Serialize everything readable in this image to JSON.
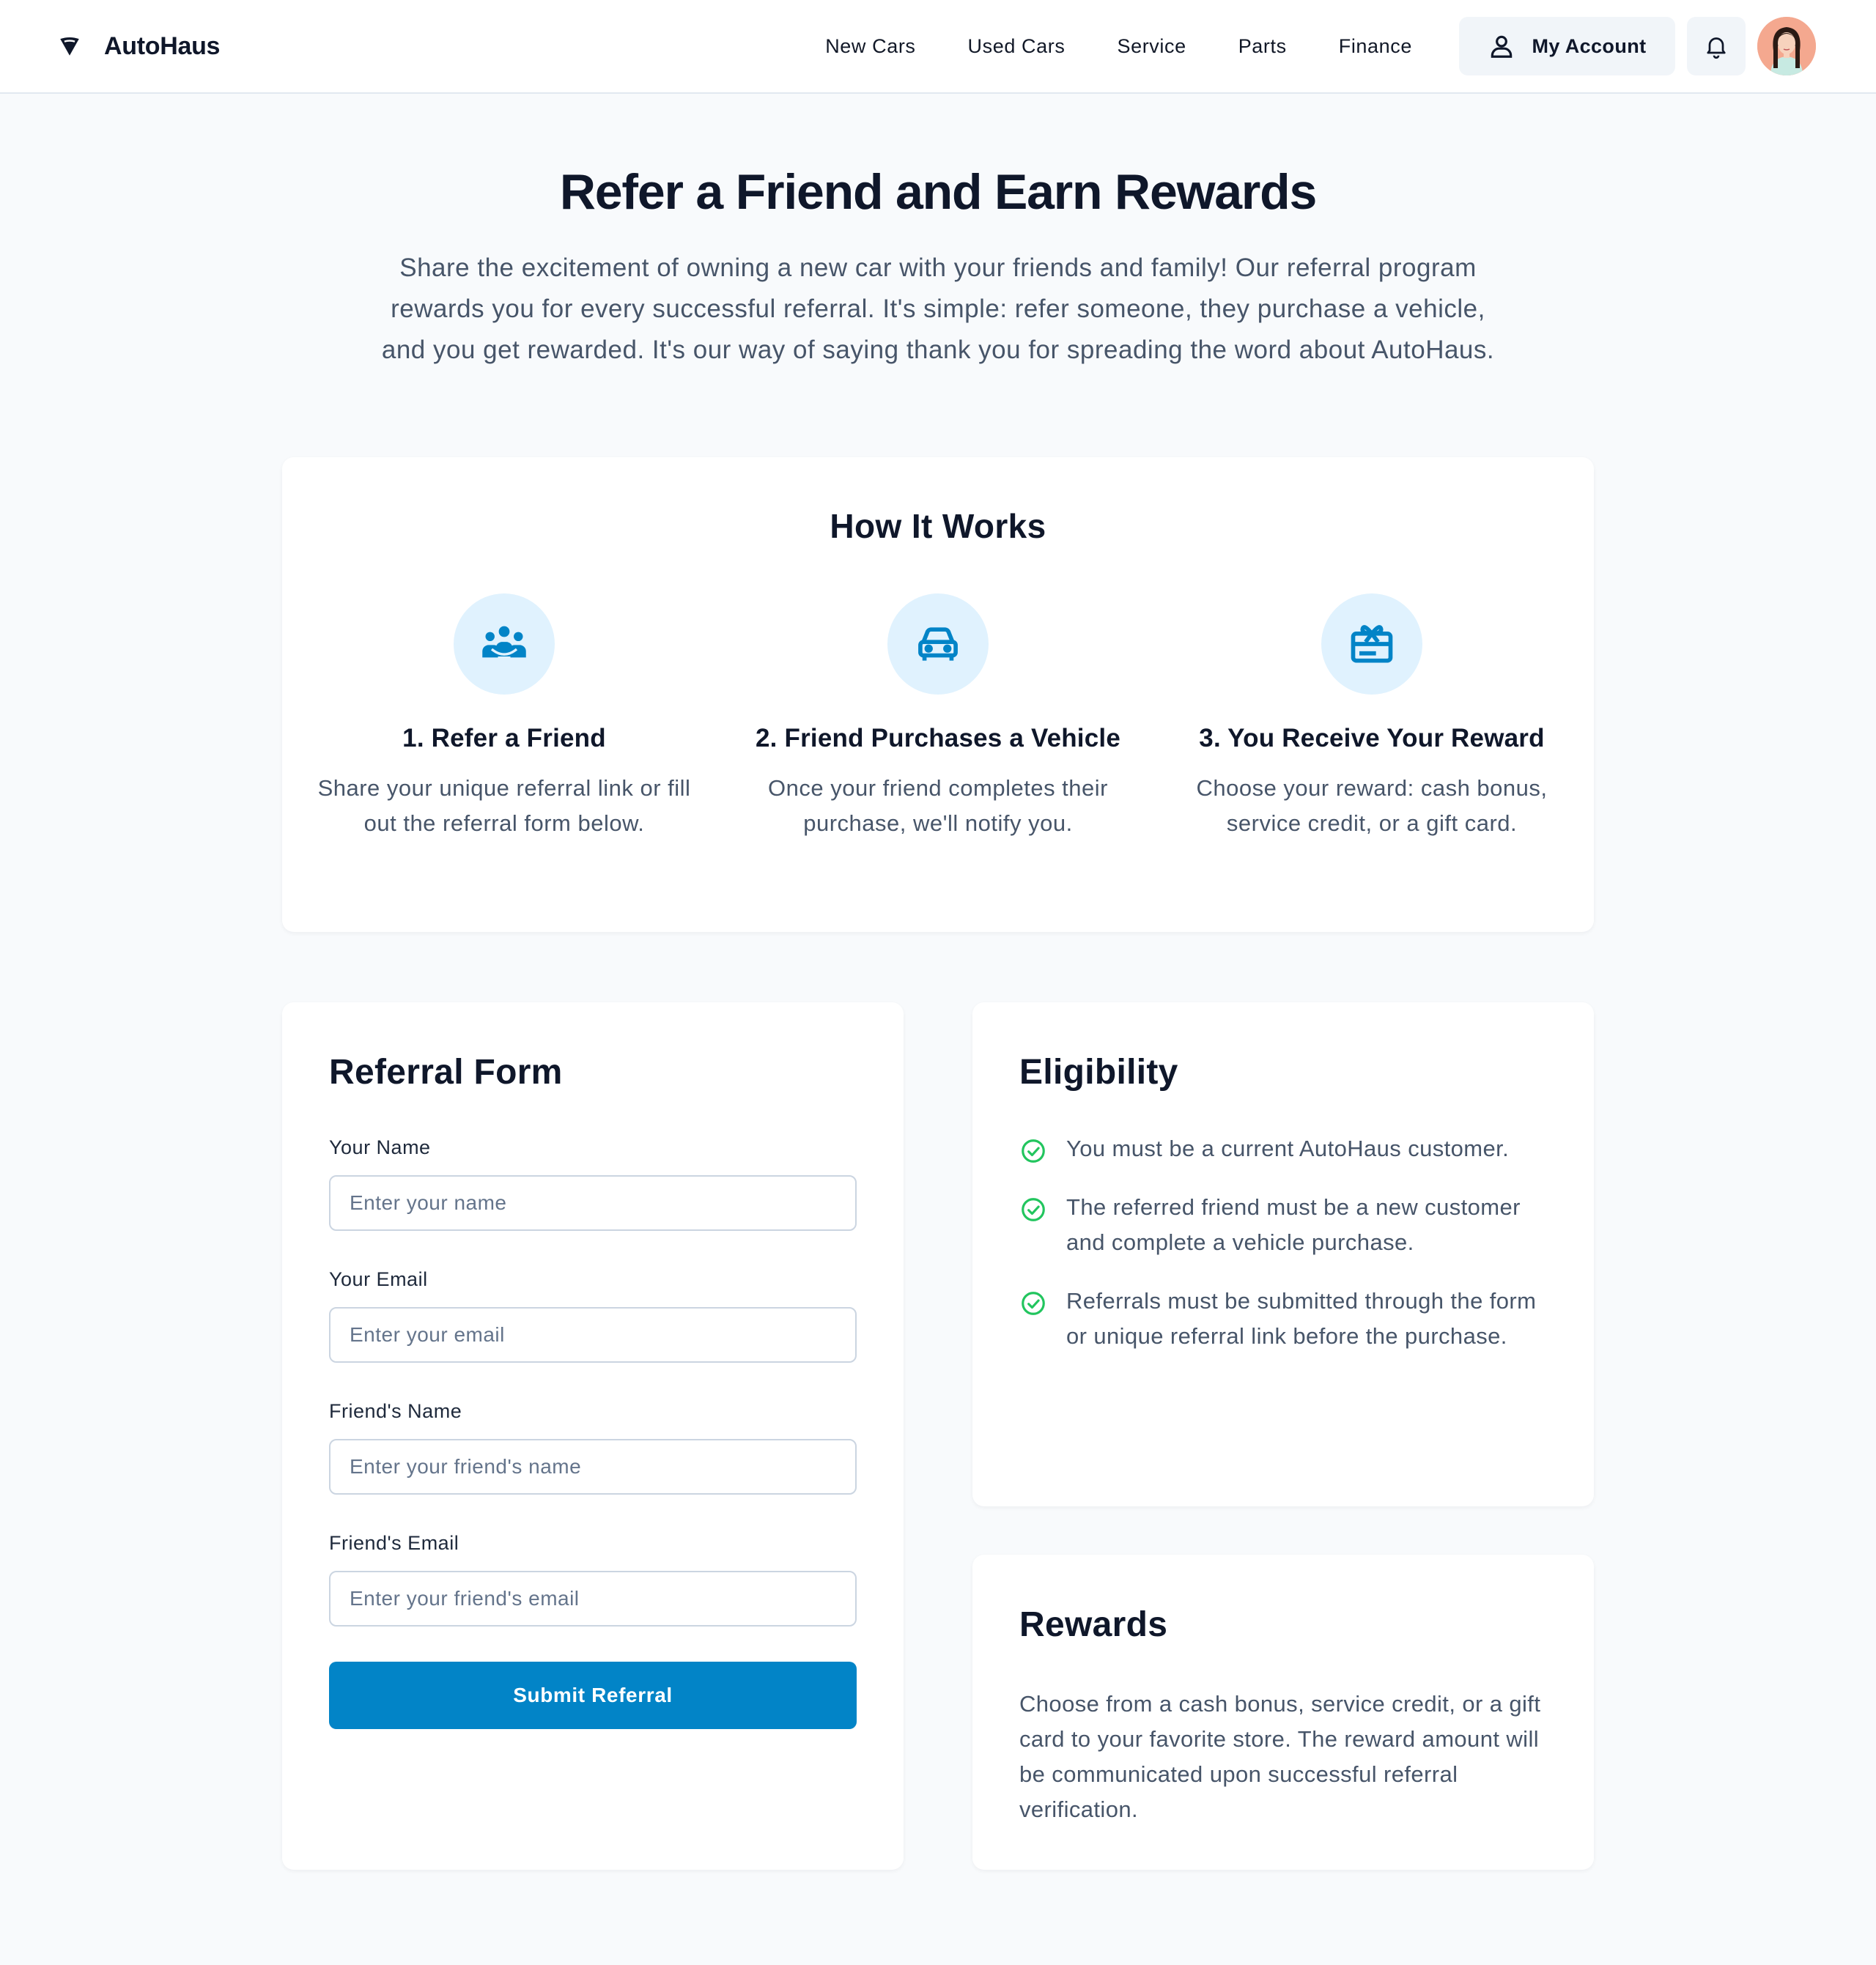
{
  "brand": {
    "name": "AutoHaus",
    "icon": "autohaus-logo-icon"
  },
  "nav": {
    "links": [
      "New Cars",
      "Used Cars",
      "Service",
      "Parts",
      "Finance"
    ],
    "account_label": "My Account",
    "account_icon": "user-icon",
    "bell_icon": "bell-icon",
    "avatar_icon": "avatar"
  },
  "hero": {
    "title": "Refer a Friend and Earn Rewards",
    "description": "Share the excitement of owning a new car with your friends and family! Our referral program rewards you for every successful referral. It's simple: refer someone, they purchase a vehicle, and you get rewarded. It's our way of saying thank you for spreading the word about AutoHaus."
  },
  "how": {
    "title": "How It Works",
    "steps": [
      {
        "icon": "people-group-icon",
        "title": "1. Refer a Friend",
        "text": "Share your unique referral link or fill out the referral form below."
      },
      {
        "icon": "car-icon",
        "title": "2. Friend Purchases a Vehicle",
        "text": "Once your friend completes their purchase, we'll notify you."
      },
      {
        "icon": "gift-card-icon",
        "title": "3. You Receive Your Reward",
        "text": "Choose your reward: cash bonus, service credit, or a gift card."
      }
    ]
  },
  "form": {
    "title": "Referral Form",
    "fields": [
      {
        "label": "Your Name",
        "placeholder": "Enter your name",
        "value": ""
      },
      {
        "label": "Your Email",
        "placeholder": "Enter your email",
        "value": ""
      },
      {
        "label": "Friend's Name",
        "placeholder": "Enter your friend's name",
        "value": ""
      },
      {
        "label": "Friend's Email",
        "placeholder": "Enter your friend's email",
        "value": ""
      }
    ],
    "submit_label": "Submit Referral"
  },
  "eligibility": {
    "title": "Eligibility",
    "items": [
      "You must be a current AutoHaus customer.",
      "The referred friend must be a new customer and complete a vehicle purchase.",
      "Referrals must be submitted through the form or unique referral link before the purchase."
    ]
  },
  "rewards": {
    "title": "Rewards",
    "text": "Choose from a cash bonus, service credit, or a gift card to your favorite store. The reward amount will be communicated upon successful referral verification."
  },
  "colors": {
    "accent": "#0284c7",
    "icon_bg": "#e0f2fe",
    "check": "#22c55e",
    "text_dark": "#0f172a",
    "text_muted": "#475569"
  }
}
